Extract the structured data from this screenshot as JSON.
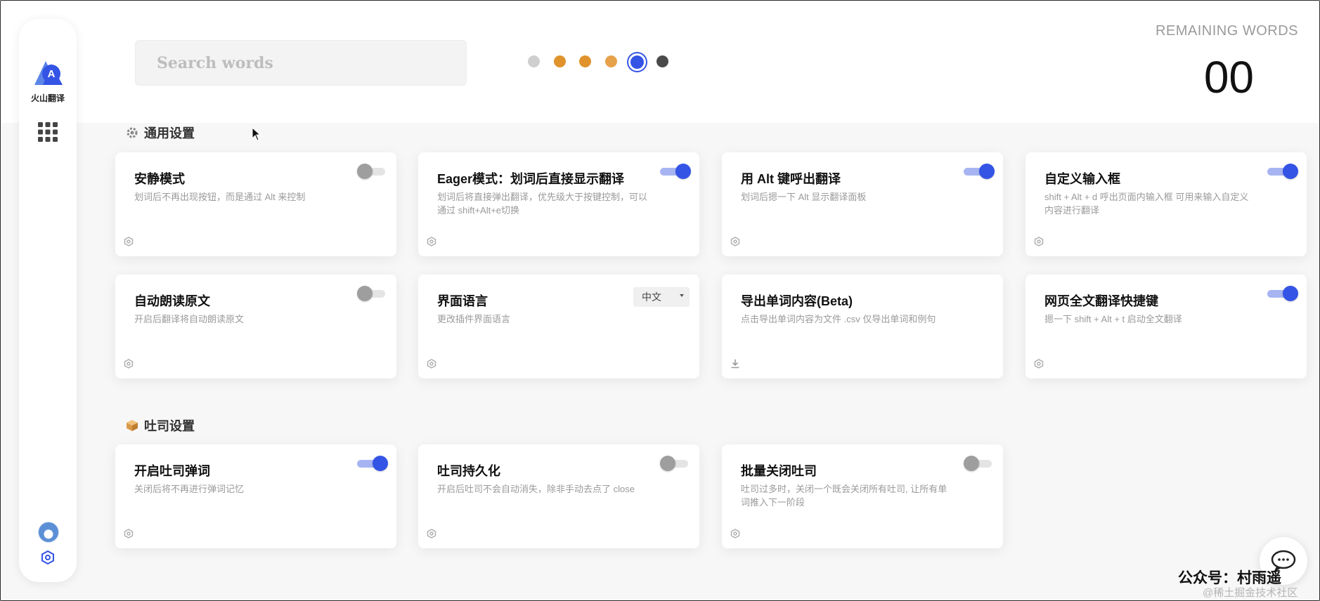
{
  "brand": {
    "logo_text": "火山翻译"
  },
  "search": {
    "placeholder": "Search words"
  },
  "progress_dots": [
    {
      "color": "#cfcfcf"
    },
    {
      "color": "#e0922b"
    },
    {
      "color": "#e0922b"
    },
    {
      "color": "#e6a14a"
    },
    {
      "color": "#3454e6",
      "active": true
    },
    {
      "color": "#4a4a4a"
    }
  ],
  "remaining": {
    "label": "REMAINING WORDS",
    "count": "00"
  },
  "sections": {
    "general": {
      "title": "通用设置",
      "cards": [
        {
          "title": "安静模式",
          "desc": "划词后不再出现按钮，而是通过 Alt 来控制",
          "control": "toggle",
          "on": false
        },
        {
          "title": "Eager模式：划词后直接显示翻译",
          "desc": "划词后将直接弹出翻译，优先级大于按键控制，可以通过 shift+Alt+e切换",
          "control": "toggle",
          "on": true
        },
        {
          "title": "用 Alt 键呼出翻译",
          "desc": "划词后摁一下 Alt 显示翻译面板",
          "control": "toggle",
          "on": true
        },
        {
          "title": "自定义输入框",
          "desc": "shift + Alt + d 呼出页面内输入框 可用来输入自定义内容进行翻译",
          "control": "toggle",
          "on": true
        },
        {
          "title": "自动朗读原文",
          "desc": "开启后翻译将自动朗读原文",
          "control": "toggle",
          "on": false
        },
        {
          "title": "界面语言",
          "desc": "更改插件界面语言",
          "control": "select",
          "value": "中文"
        },
        {
          "title": "导出单词内容(Beta)",
          "desc": "点击导出单词内容为文件 .csv 仅导出单词和例句",
          "control": "none",
          "foot_icon": "download-icon"
        },
        {
          "title": "网页全文翻译快捷键",
          "desc": "摁一下 shift + Alt + t 启动全文翻译",
          "control": "toggle",
          "on": true
        }
      ]
    },
    "toast": {
      "title": "吐司设置",
      "cards": [
        {
          "title": "开启吐司弹词",
          "desc": "关闭后将不再进行弹词记忆",
          "control": "toggle",
          "on": true
        },
        {
          "title": "吐司持久化",
          "desc": "开启后吐司不会自动消失，除非手动去点了 close",
          "control": "toggle",
          "on": false
        },
        {
          "title": "批量关闭吐司",
          "desc": "吐司过多时，关闭一个既会关闭所有吐司, 让所有单词推入下一阶段",
          "control": "toggle",
          "on": false
        }
      ]
    }
  },
  "watermark": {
    "line1": "公众号：村雨遥",
    "line2": "@稀土掘金技术社区"
  },
  "colors": {
    "accent": "#3454e6",
    "accent_light": "#a6b4f2",
    "toggle_off": "#9e9e9e"
  }
}
